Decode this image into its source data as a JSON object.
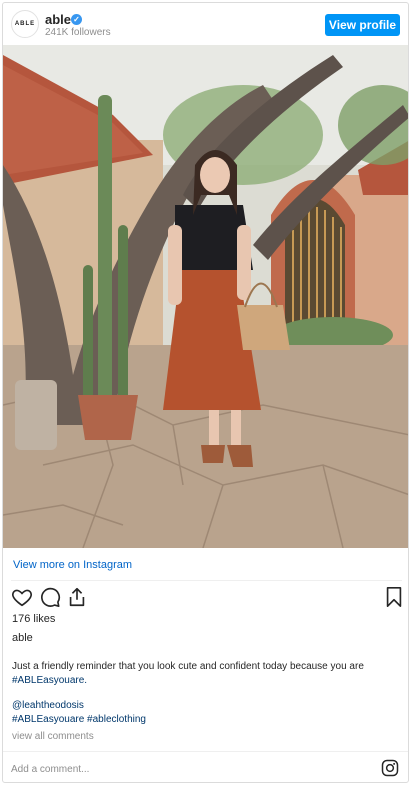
{
  "header": {
    "avatar_text": "ABLE",
    "username": "able",
    "verified_icon": "verified-badge-icon",
    "followers": "241K followers",
    "view_profile_label": "View profile"
  },
  "photo": {
    "description_icon": "post-photo"
  },
  "view_more_label": "View more on Instagram",
  "actions": {
    "like_icon": "heart-icon",
    "comment_icon": "comment-icon",
    "share_icon": "share-icon",
    "save_icon": "bookmark-icon"
  },
  "likes": "176 likes",
  "author": "able",
  "caption": {
    "text": "Just a friendly reminder that you look cute and confident today because you are",
    "hashtag": "#ABLEasyouare."
  },
  "credit": "@leahtheodosis",
  "tags": "#ABLEasyouare #ableclothing",
  "view_all_comments": "view all comments",
  "comment": {
    "placeholder": "Add a comment..."
  },
  "colors": {
    "accent": "#0095f6",
    "link": "#0064c8",
    "hashtag": "#00376b",
    "muted": "#8e8e8e"
  }
}
